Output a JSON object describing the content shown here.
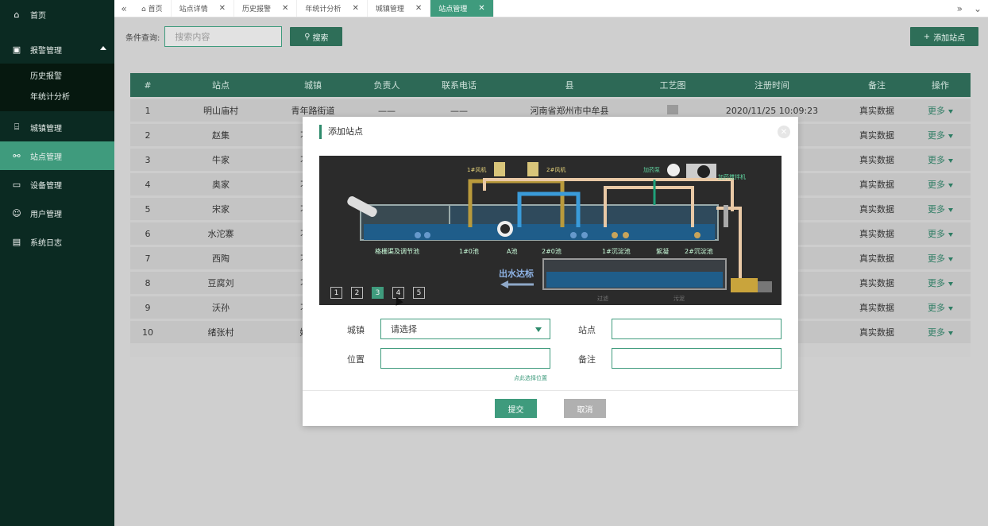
{
  "sidebar": {
    "items": [
      {
        "label": "首页",
        "icon": "home-icon"
      },
      {
        "label": "报警管理",
        "icon": "alarm-icon"
      },
      {
        "label": "城镇管理",
        "icon": "building-icon"
      },
      {
        "label": "站点管理",
        "icon": "sitemap-icon"
      },
      {
        "label": "设备管理",
        "icon": "device-icon"
      },
      {
        "label": "用户管理",
        "icon": "user-icon"
      },
      {
        "label": "系统日志",
        "icon": "log-icon"
      }
    ],
    "subitems": [
      "历史报警",
      "年统计分析"
    ]
  },
  "tabs": [
    {
      "label": "首页"
    },
    {
      "label": "站点详情"
    },
    {
      "label": "历史报警"
    },
    {
      "label": "年统计分析"
    },
    {
      "label": "城镇管理"
    },
    {
      "label": "站点管理"
    }
  ],
  "search": {
    "label": "条件查询:",
    "placeholder": "搜索内容",
    "button": "搜索",
    "add_button": "添加站点"
  },
  "table": {
    "headers": [
      "#",
      "站点",
      "城镇",
      "负责人",
      "联系电话",
      "县",
      "工艺图",
      "注册时间",
      "备注",
      "操作"
    ],
    "rows": [
      {
        "no": "1",
        "site": "明山庙村",
        "town": "青年路街道",
        "person": "——",
        "phone": "——",
        "county": "河南省郑州市中牟县",
        "time": "2020/11/25 10:09:23",
        "note": "真实数据",
        "op": "更多"
      },
      {
        "no": "2",
        "site": "赵集",
        "town": "刁家乡",
        "note": "真实数据",
        "op": "更多"
      },
      {
        "no": "3",
        "site": "牛家",
        "town": "刁家乡",
        "note": "真实数据",
        "op": "更多"
      },
      {
        "no": "4",
        "site": "奥家",
        "town": "刁家乡",
        "note": "真实数据",
        "op": "更多"
      },
      {
        "no": "5",
        "site": "宋家",
        "town": "刁家乡",
        "note": "真实数据",
        "op": "更多"
      },
      {
        "no": "6",
        "site": "水沱寨",
        "town": "刁家乡",
        "note": "真实数据",
        "op": "更多"
      },
      {
        "no": "7",
        "site": "西陶",
        "town": "刁家乡",
        "note": "真实数据",
        "op": "更多"
      },
      {
        "no": "8",
        "site": "豆腐刘",
        "town": "刁家乡",
        "note": "真实数据",
        "op": "更多"
      },
      {
        "no": "9",
        "site": "沃孙",
        "town": "刁家乡",
        "note": "真实数据",
        "op": "更多"
      },
      {
        "no": "10",
        "site": "绪张村",
        "town": "姚家镇",
        "note": "真实数据",
        "op": "更多"
      }
    ]
  },
  "modal": {
    "title": "添加站点",
    "diagram_labels": [
      "1#风机",
      "2#风机",
      "加药泵",
      "加药搅拌机",
      "格栅渠及调节池",
      "1#0池",
      "A池",
      "2#0池",
      "1#沉淀池",
      "絮凝",
      "2#沉淀池",
      "出水达标",
      "过滤",
      "污泥"
    ],
    "pager": [
      "1",
      "2",
      "3",
      "4",
      "5"
    ],
    "active_page": "3",
    "town_label": "城镇",
    "town_value": "请选择",
    "site_label": "站点",
    "position_label": "位置",
    "note_label": "备注",
    "hint": "点此选择位置",
    "submit": "提交",
    "cancel": "取消"
  },
  "colors": {
    "accent": "#3f9b7d",
    "sidebar": "#0b2a22",
    "table_header": "#2d6956"
  }
}
